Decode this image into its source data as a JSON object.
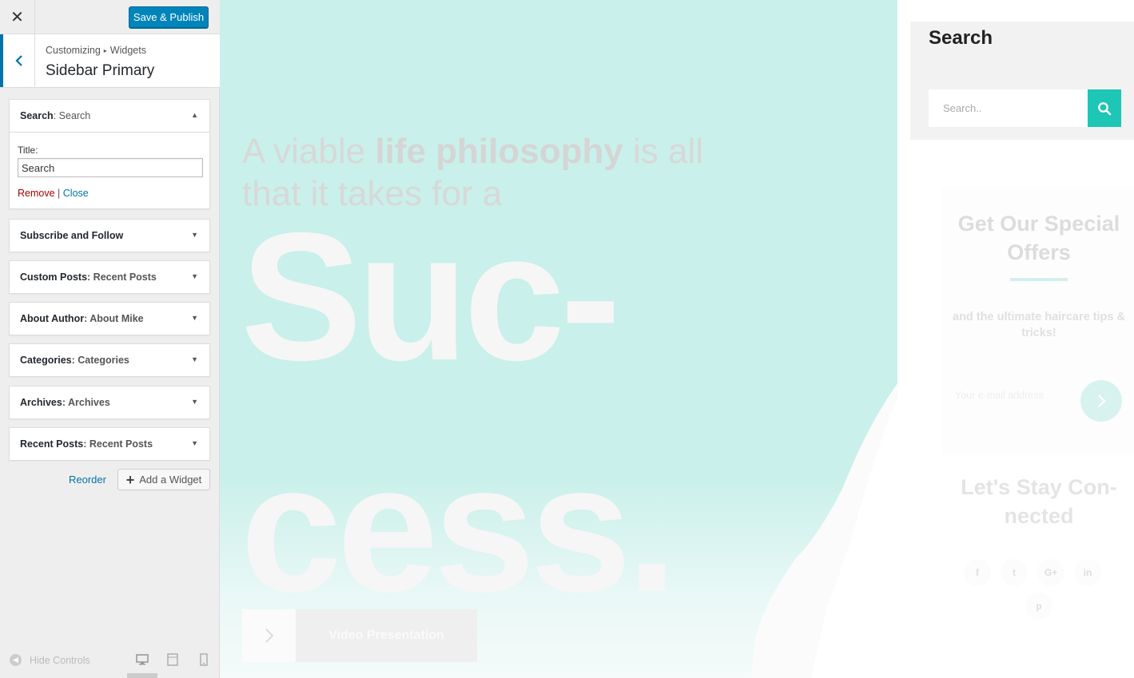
{
  "header": {
    "close_glyph": "✕",
    "publish_label": "Save & Publish"
  },
  "section": {
    "breadcrumb_root": "Customizing",
    "breadcrumb_sep": "▸",
    "breadcrumb_leaf": "Widgets",
    "title": "Sidebar Primary"
  },
  "widgets": [
    {
      "name": "Search",
      "sub": ": Search",
      "expanded": true
    },
    {
      "name": "Subscribe and Follow",
      "sub": ""
    },
    {
      "name": "Custom Posts",
      "sub": ": Recent Posts"
    },
    {
      "name": "About Author",
      "sub": ": About Mike"
    },
    {
      "name": "Categories",
      "sub": ": Categories"
    },
    {
      "name": "Archives",
      "sub": ": Archives"
    },
    {
      "name": "Recent Posts",
      "sub": ": Recent Posts"
    }
  ],
  "search_widget": {
    "title_label": "Title:",
    "title_value": "Search",
    "remove_label": "Remove",
    "pipe": "|",
    "close_label": "Close"
  },
  "actions": {
    "reorder_label": "Reorder",
    "add_widget_label": "Add a Widget"
  },
  "footer": {
    "hide_controls_label": "Hide Controls",
    "active_device": "desktop"
  },
  "preview": {
    "tagline_pre": "A viable ",
    "tagline_bold": "life philosophy",
    "tagline_post": " is all that it takes for a",
    "big_line1": "Suc-",
    "big_line2": "cess.",
    "video_label": "Video Presentation",
    "sidebar": {
      "search_title": "Search",
      "search_placeholder": "Search..",
      "offer_title": "Get Our Special Offers",
      "offer_sub": "and the ultimate haircare tips & tricks!",
      "email_placeholder": "Your e-mail address",
      "stay_title": "Let's Stay Con-nected",
      "social": [
        "f",
        "t",
        "G+",
        "in",
        "p"
      ]
    }
  },
  "colors": {
    "accent": "#0085ba",
    "link": "#0073aa",
    "remove": "#aa0000",
    "hero_bg": "#c9f0ea",
    "search_btn": "#1dc6b5"
  }
}
